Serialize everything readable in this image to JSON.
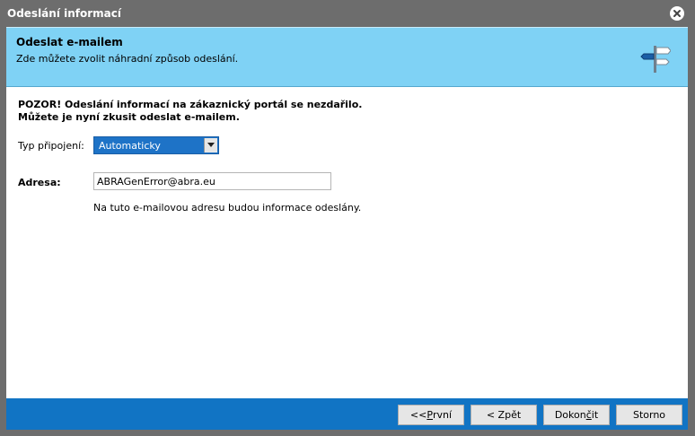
{
  "window": {
    "title": "Odeslání informací"
  },
  "header": {
    "title": "Odeslat e-mailem",
    "subtitle": "Zde můžete zvolit náhradní způsob odeslání.",
    "icon": "signpost-icon"
  },
  "warning": {
    "line1": "POZOR! Odeslání informací na zákaznický portál se nezdařilo.",
    "line2": "Můžete je nyní zkusit odeslat e-mailem."
  },
  "form": {
    "connection_label": "Typ připojení:",
    "connection_value": "Automaticky",
    "address_label": "Adresa:",
    "address_value": "ABRAGenError@abra.eu",
    "hint": "Na tuto e-mailovou adresu budou informace odeslány."
  },
  "buttons": {
    "first_prefix": "<< ",
    "first_mnemonic": "P",
    "first_rest": "rvní",
    "prev": "< Zpět",
    "finish_prefix": "Dokon",
    "finish_mnemonic": "č",
    "finish_rest": "it",
    "cancel": "Storno"
  },
  "colors": {
    "header_bg": "#7fd2f5",
    "footer_bg": "#1174c4",
    "select_bg": "#1e73c7",
    "titlebar_bg": "#6d6d6d"
  }
}
